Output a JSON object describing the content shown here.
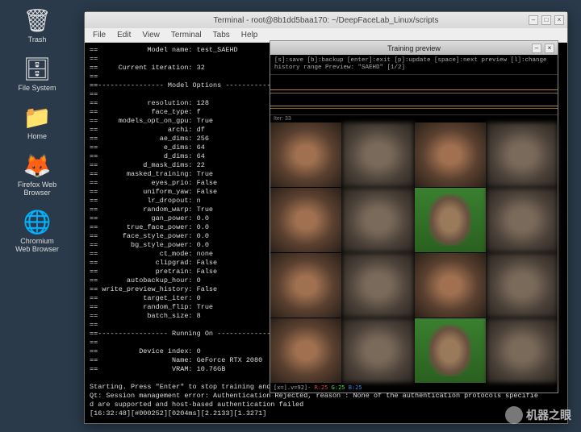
{
  "desktop_icons": [
    {
      "name": "trash-icon",
      "glyph": "🗑",
      "label": "Trash"
    },
    {
      "name": "filesystem-icon",
      "glyph": "🗄",
      "label": "File System"
    },
    {
      "name": "home-icon",
      "glyph": "📁",
      "label": "Home"
    },
    {
      "name": "firefox-icon",
      "glyph": "🦊",
      "label": "Firefox Web\nBrowser"
    },
    {
      "name": "chromium-icon",
      "glyph": "🌐",
      "label": "Chromium\nWeb Browser"
    }
  ],
  "terminal": {
    "title": "Terminal - root@8b1dd5baa170: ~/DeepFaceLab_Linux/scripts",
    "menu": [
      "File",
      "Edit",
      "View",
      "Terminal",
      "Tabs",
      "Help"
    ],
    "model_name": "test_SAEHD",
    "current_iter": "32",
    "options": [
      [
        "resolution",
        "128"
      ],
      [
        "face_type",
        "f"
      ],
      [
        "models_opt_on_gpu",
        "True"
      ],
      [
        "archi",
        "df"
      ],
      [
        "ae_dims",
        "256"
      ],
      [
        "e_dims",
        "64"
      ],
      [
        "d_dims",
        "64"
      ],
      [
        "d_mask_dims",
        "22"
      ],
      [
        "masked_training",
        "True"
      ],
      [
        "eyes_prio",
        "False"
      ],
      [
        "uniform_yaw",
        "False"
      ],
      [
        "lr_dropout",
        "n"
      ],
      [
        "random_warp",
        "True"
      ],
      [
        "gan_power",
        "0.0"
      ],
      [
        "true_face_power",
        "0.0"
      ],
      [
        "face_style_power",
        "0.0"
      ],
      [
        "bg_style_power",
        "0.0"
      ],
      [
        "ct_mode",
        "none"
      ],
      [
        "clipgrad",
        "False"
      ],
      [
        "pretrain",
        "False"
      ],
      [
        "autobackup_hour",
        "0"
      ],
      [
        "write_preview_history",
        "False"
      ],
      [
        "target_iter",
        "0"
      ],
      [
        "random_flip",
        "True"
      ],
      [
        "batch_size",
        "8"
      ]
    ],
    "running_on": {
      "device_index": "0",
      "name": "GeForce RTX 2080",
      "vram": "10.76GB"
    },
    "footer_lines": [
      "Starting. Press \"Enter\" to stop training and save model.",
      "Qt: Session management error: Authentication Rejected, reason : None of the authentication protocols specifie",
      "d are supported and host-based authentication failed",
      "[16:32:48][#000252][0204ms][2.2133][1.3271]"
    ]
  },
  "preview": {
    "title": "Training preview",
    "info_lines": [
      "[s]:save [b]:backup [enter]:exit",
      "[p]:update [space]:next preview [l]:change history range",
      "Preview: \"SAEHD\" [1/2]"
    ],
    "iter_label": "Iter: 33",
    "footer": {
      "prefix": "[x=].v=92]-",
      "r": "R:25",
      "g": "G:25",
      "b": "B:25"
    }
  },
  "watermark": "机器之眼"
}
